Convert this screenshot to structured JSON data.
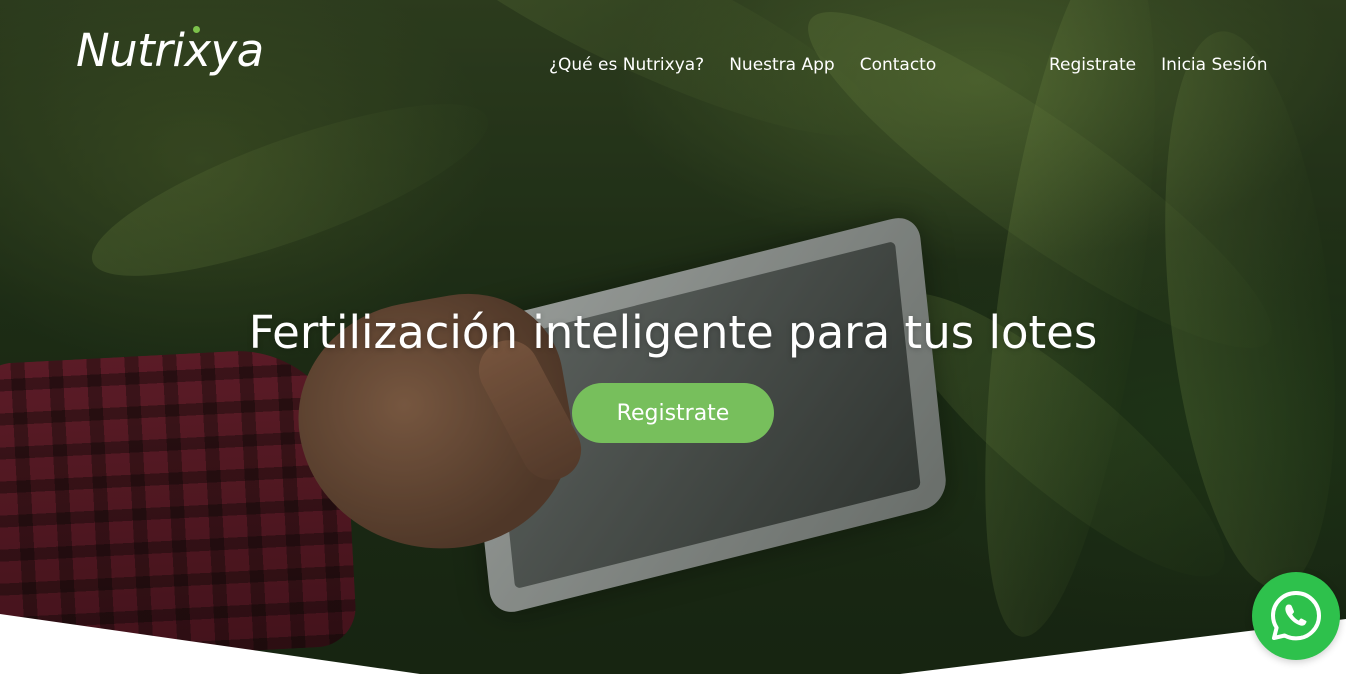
{
  "brand": {
    "logo_text": "Nutrixya",
    "accent_color": "#77bf5c"
  },
  "nav": {
    "main_links": [
      {
        "label": "¿Qué es Nutrixya?"
      },
      {
        "label": "Nuestra App"
      },
      {
        "label": "Contacto"
      }
    ],
    "auth_links": [
      {
        "label": "Registrate"
      },
      {
        "label": "Inicia Sesión"
      }
    ]
  },
  "hero": {
    "title": "Fertilización inteligente para tus lotes",
    "cta_label": "Registrate"
  },
  "floating": {
    "whatsapp_icon": "whatsapp-icon",
    "whatsapp_color": "#2ec14c"
  }
}
